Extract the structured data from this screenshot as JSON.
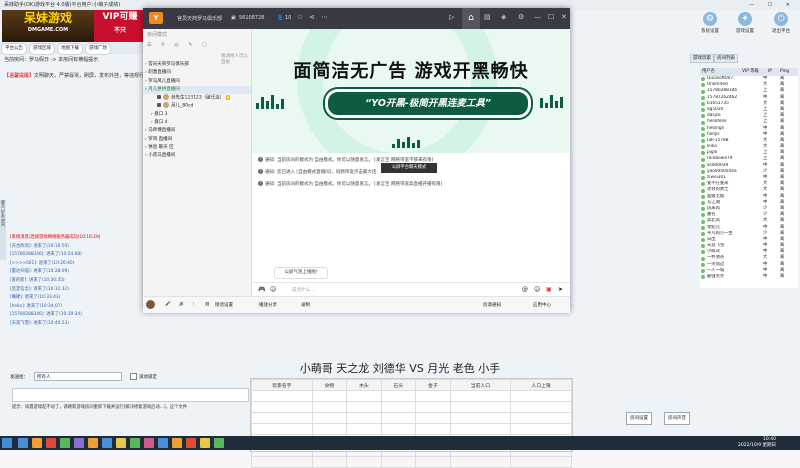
{
  "bg_window": {
    "title": "呆妹助手(DK)游戏平台 4.0版(平台用户:小萌子成绩)",
    "logo_main": "呆妹游戏",
    "logo_sub": "DMGAME.COM",
    "vip_text": "VIP可赚",
    "vip_sub": "不只",
    "toolbar": [
      "平台公告",
      "游戏区域",
      "地图下载",
      "游戏广场"
    ],
    "room_link": "当前房间：罗马假日 -> 本房间有横幅提示",
    "notice_tag": "【温馨提醒】",
    "notice_text": "文明聊天，严禁辱骂，刷屏，发布外挂，等违规行为",
    "side_tabs": "聊天 好友 房间",
    "log": [
      {
        "text": "[系统消息]连接游戏网络服务器成功(10:16:29)",
        "type": "sys"
      },
      {
        "text": "[天台吹风]: 进来了(10:16:50)",
        "type": "u"
      },
      {
        "text": "[15780288346]: 进来了(10:24:08)",
        "type": "u"
      },
      {
        "text": "[>>>>001]: 进来了(10:26:40)",
        "type": "u"
      },
      {
        "text": "[雷达扫描]: 进来了(10:28:09)",
        "type": "u"
      },
      {
        "text": "[爱的新]: 进来了(10:30:35)",
        "type": "u"
      },
      {
        "text": "[坚定信念]: 进来了(10:31:32)",
        "type": "u"
      },
      {
        "text": "[嘴硬]: 进来了(10:33:43)",
        "type": "u"
      },
      {
        "text": "[hello]: 进来了(10:34:07)",
        "type": "u"
      },
      {
        "text": "[15780288346]: 进来了(10:39:34)",
        "type": "u"
      },
      {
        "text": "[天涯飞雪]: 进来了(10:40:23)",
        "type": "u"
      }
    ],
    "send_label": "发送给：",
    "send_target": "所有人",
    "scroll_lock": "滚动锁定",
    "tip": "提示：如遇游戏起不动了，请刷新游戏房间重新下载并运行[解决修复游戏启动...]，这个文件",
    "right_icons": [
      "系统设置",
      "游戏设置",
      "退出平台"
    ],
    "right_tabs": [
      "游戏玩家",
      "房间列表"
    ],
    "right_redlink": "平台公告",
    "right_header": {
      "name": "用户名",
      "level": "VIP 等级",
      "loc": "IP",
      "status": "Ping"
    },
    "users": [
      {
        "name": "Quiasoft007",
        "loc": "中",
        "st": "离"
      },
      {
        "name": "Unlimited",
        "loc": "大",
        "st": "离"
      },
      {
        "name": "15780288346",
        "loc": "上",
        "st": "离"
      },
      {
        "name": "15787262462",
        "loc": "中",
        "st": "离"
      },
      {
        "name": "61651735",
        "loc": "大",
        "st": "离"
      },
      {
        "name": "ag5020",
        "loc": "上",
        "st": "离"
      },
      {
        "name": "dasjsa",
        "loc": "上",
        "st": "离"
      },
      {
        "name": "hellofenk",
        "loc": "上",
        "st": "离"
      },
      {
        "name": "helongli",
        "loc": "中",
        "st": "离"
      },
      {
        "name": "hollys",
        "loc": "中",
        "st": "离"
      },
      {
        "name": "LBF15788",
        "loc": "大",
        "st": "离"
      },
      {
        "name": "lilika",
        "loc": "大",
        "st": "离"
      },
      {
        "name": "pigili",
        "loc": "上",
        "st": "离"
      },
      {
        "name": "rainbow479",
        "loc": "上",
        "st": "离"
      },
      {
        "name": "xsd00039",
        "loc": "中",
        "st": "离"
      },
      {
        "name": "yao0040044a",
        "loc": "少",
        "st": "离"
      },
      {
        "name": "ziwei301",
        "loc": "中",
        "st": "离"
      },
      {
        "name": "爱不在重来",
        "loc": "大",
        "st": "离"
      },
      {
        "name": "冰封的勇士",
        "loc": "大",
        "st": "离"
      },
      {
        "name": "超级无敌",
        "loc": "中",
        "st": "离"
      },
      {
        "name": "东江湖",
        "loc": "中",
        "st": "离"
      },
      {
        "name": "风来风",
        "loc": "少",
        "st": "离"
      },
      {
        "name": "嘉名",
        "loc": "少",
        "st": "离"
      },
      {
        "name": "卖北风",
        "loc": "大",
        "st": "离"
      },
      {
        "name": "零纪元",
        "loc": "中",
        "st": "离"
      },
      {
        "name": "平凡的小一生",
        "loc": "少",
        "st": "离"
      },
      {
        "name": "日出",
        "loc": "中",
        "st": "离"
      },
      {
        "name": "天涯飞雪",
        "loc": "中",
        "st": "离"
      },
      {
        "name": "小萌哥",
        "loc": "中",
        "st": "离"
      },
      {
        "name": "一杯清茶",
        "loc": "大",
        "st": "离"
      },
      {
        "name": "一笑而过",
        "loc": "中",
        "st": "离"
      },
      {
        "name": "一人一城",
        "loc": "中",
        "st": "离"
      },
      {
        "name": "最强笑笑",
        "loc": "中",
        "st": "离"
      }
    ],
    "btn_room": "房间设置",
    "btn_sound": "房间声音"
  },
  "chat": {
    "app_name": "官员天商罗马俱乐部",
    "id": "56108728",
    "members": "10",
    "search_hint": "房间模式",
    "invite": "邀请他人可以直接",
    "tree": [
      {
        "label": "官员天商罗马俱乐部",
        "cls": "",
        "indent": 2
      },
      {
        "label": "刺激直播间",
        "cls": "",
        "indent": 2
      },
      {
        "label": "罗马风儿直播间",
        "cls": "",
        "indent": 2
      },
      {
        "label": "月儿拼拼直播间",
        "cls": "sel gn",
        "indent": 2
      },
      {
        "label": "浪先生123123（破迁连）",
        "cls": "user",
        "indent": 14
      },
      {
        "label": "月儿_80cd",
        "cls": "user",
        "indent": 14
      },
      {
        "label": "盘口 3",
        "cls": "",
        "indent": 8
      },
      {
        "label": "盘口 4",
        "cls": "",
        "indent": 8
      },
      {
        "label": "马师傅直播间",
        "cls": "",
        "indent": 2
      },
      {
        "label": "罗哥 直播间",
        "cls": "",
        "indent": 2
      },
      {
        "label": "休息 聊天 区",
        "cls": "",
        "indent": 2
      },
      {
        "label": "小黑马直播间",
        "cls": "",
        "indent": 2
      }
    ],
    "banner_title": "面简洁无广告  游戏开黑畅快",
    "banner_slogan": "“YO开黑-极简开黑连麦工具”",
    "notes": [
      "通知: 当前房间的模式为 自由模式。你可以随意发言。 [发言至    网络带宽不够来有限]",
      "通知: 您已进入 [自由模式直播间]，同频带宽点击最大话",
      "通知: 当前房间的模式为 自由模式。你可以随意发言。 [发言至    网络带宽高直播开播有限]"
    ],
    "tooltip": "公屏平台聊天模式",
    "pub_tip": "公屏气泡上线啦!",
    "input_placeholder": "说点什么...",
    "bottom": {
      "my_setting": "接话设置",
      "volume": "播放分享",
      "record": "录制",
      "room_setting": "房源通知",
      "gift": "应用中心"
    }
  },
  "overlay": {
    "matchup": "小萌哥 天之龙 刘德华 VS 月光 老色 小手",
    "table_headers": [
      "玩家名字",
      "食物",
      "木头",
      "石头",
      "金子",
      "当前人口",
      "人口上限"
    ]
  },
  "clock": {
    "time": "10:40",
    "date": "2022/10/9 星期日"
  }
}
